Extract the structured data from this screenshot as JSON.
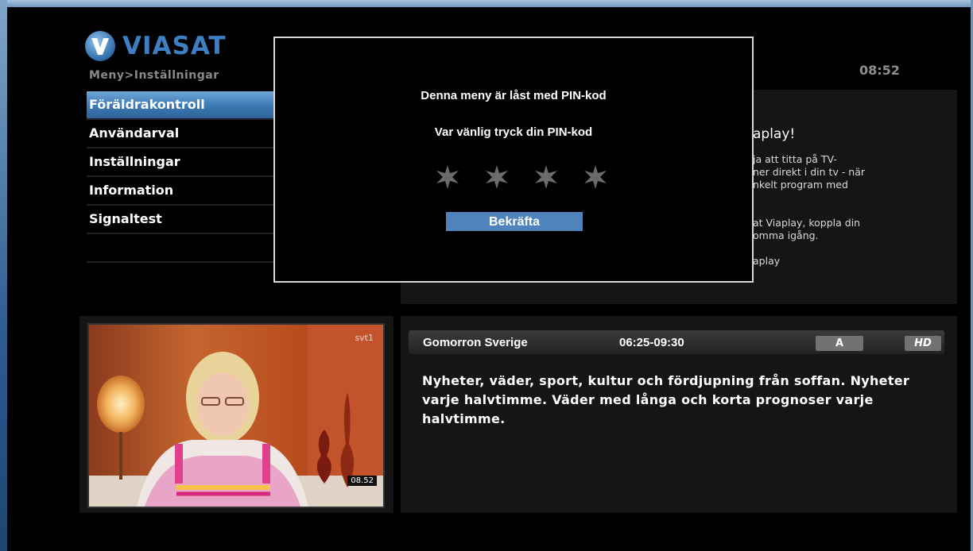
{
  "header": {
    "brand": "VIASAT",
    "breadcrumb": "Meny>Inställningar",
    "clock": "08:52"
  },
  "menu": {
    "items": [
      {
        "label": "Föräldrakontroll",
        "selected": true
      },
      {
        "label": "Användarval",
        "selected": false
      },
      {
        "label": "Inställningar",
        "selected": false
      },
      {
        "label": "Information",
        "selected": false
      },
      {
        "label": "Signaltest",
        "selected": false
      }
    ]
  },
  "info_panel": {
    "title": "aplay!",
    "lines": [
      "ja att titta på TV-",
      "ner direkt i din tv - när",
      "nkelt program med",
      "at Viaplay, koppla din",
      "omma igång.",
      "aplay"
    ]
  },
  "dialog": {
    "message": "Denna meny är låst med PIN-kod",
    "prompt": "Var vänlig tryck din PIN-kod",
    "pin_digits_entered": 0,
    "pin_length": 4,
    "confirm_label": "Bekräfta"
  },
  "video": {
    "channel_logo": "svt1",
    "timestamp": "08.52"
  },
  "program": {
    "name": "Gomorron Sverige",
    "time": "06:25-09:30",
    "badge_rating": "A",
    "badge_hd": "HD",
    "description": "Nyheter, väder, sport, kultur och fördjupning från soffan. Nyheter varje halvtimme. Väder med långa och korta prognoser varje halvtimme."
  },
  "colors": {
    "accent_blue": "#4f83bb",
    "menu_selected": "#3f7bb6",
    "brand_blue": "#3d7fc2"
  }
}
